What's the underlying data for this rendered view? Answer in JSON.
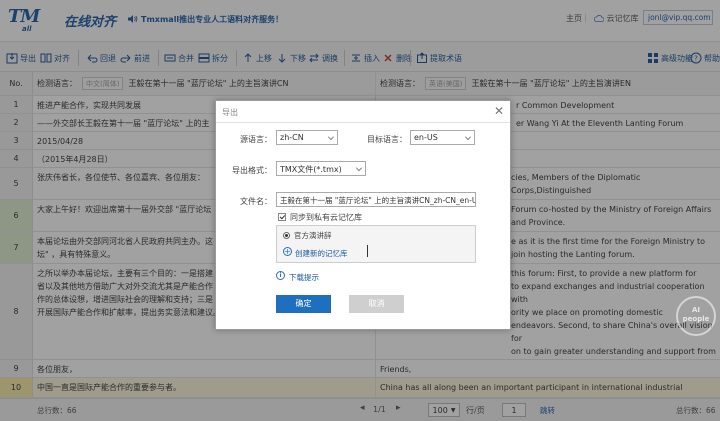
{
  "header": {
    "logo_mark": "TM",
    "logo_sub": "all",
    "logo_cn": "在线对齐",
    "announcement": "Tmxmall推出专业人工语料对齐服务！",
    "nav_home": "主页",
    "nav_cloud": "云记忆库",
    "user": "jonl@vip.qq.com"
  },
  "toolbar": {
    "export": "导出",
    "align": "对齐",
    "back": "回退",
    "forward": "前进",
    "merge": "合并",
    "split": "拆分",
    "move_up": "上移",
    "move_down": "下移",
    "swap": "调换",
    "insert": "插入",
    "delete": "删除",
    "extract_terms": "提取术语",
    "advanced": "高级功能",
    "help": "帮助"
  },
  "grid": {
    "header": {
      "no": "No.",
      "src_detect_label": "检测语言：",
      "src_lang": "中文(简体)",
      "src_file": "王毅在第十一届 \"蓝厅论坛\" 上的主旨演讲CN",
      "tgt_detect_label": "检测语言：",
      "tgt_lang": "英语(美国)",
      "tgt_file": "王毅在第十一届 \"蓝厅论坛\" 上的主旨演讲EN"
    },
    "rows": [
      {
        "no": "1",
        "src": "推进产能合作，实现共同发展",
        "tgt": "r Common Development"
      },
      {
        "no": "2",
        "src": "——外交部长王毅在第十一届 \"蓝厅论坛\" 上的主",
        "tgt": "er Wang Yi At the Eleventh Lanting Forum"
      },
      {
        "no": "3",
        "src": "2015/04/28",
        "tgt": ""
      },
      {
        "no": "4",
        "src": "（2015年4月28日）",
        "tgt": ""
      },
      {
        "no": "5",
        "src": "张庆伟省长，各位使节、各位嘉宾、各位朋友：",
        "tgt": "cies, Members of the Diplomatic Corps,Distinguished"
      },
      {
        "no": "6",
        "src": "大家上午好！欢迎出席第十一届外交部 \"蓝厅论坛",
        "tgt": "Forum co-hosted by the Ministry of Foreign Affairs and Province."
      },
      {
        "no": "7",
        "src": "本届论坛由外交部同河北省人民政府共同主办。这\n坛\" ，具有特殊意义。",
        "tgt": "e as it is the first time for the Foreign Ministry to join hosting the Lanting forum."
      },
      {
        "no": "8",
        "src": "之所以举办本届论坛，主要有三个目的：一是搭建\n省以及其他地方借助广大对外交流尤其是产能合作\n作的总体设想，增进国际社会的理解和支持；三是\n开展国际产能合作和扩献率，提出务实意法和建议。",
        "tgt": "this forum: First, to provide a new platform for\nto expand exchanges and industrial cooperation with\nority we place on promoting domestic\nendeavors. Second, to share China's overall vision for\non to gain greater understanding and support from the\ninternational community. Third, to encourage companies, experts, scholars and people\nfrom various sectors to contribute thoughts and wisdom to China's industrial\ncooperation with the rest of the world."
      },
      {
        "no": "9",
        "src": "各位朋友，",
        "tgt": "Friends,"
      },
      {
        "no": "10",
        "src": "中国一直是国际产能合作的重要参与者。",
        "tgt": "China has all along been an important participant in international industrial cooperation."
      }
    ]
  },
  "statusbar": {
    "src_count": "总行数：66",
    "page": "1/1",
    "page_size": "100",
    "per_page": "行/页",
    "goto_value": "1",
    "goto": "跳转",
    "tgt_count": "总行数：66"
  },
  "dialog": {
    "title": "导出",
    "src_lang_label": "源语言：",
    "src_lang_value": "zh-CN",
    "tgt_lang_label": "目标语言：",
    "tgt_lang_value": "en-US",
    "format_label": "导出格式：",
    "format_value": "TMX文件(*.tmx)",
    "filename_label": "文件名：",
    "filename_value": "王毅在第十一届 \"蓝厅论坛\" 上的主旨演讲CN_zh-CN_en-U",
    "sync_label": "同步到私有云记忆库",
    "tm_option": "官方演讲辞",
    "create_tm": "创建新的记忆库",
    "download_tip": "下载提示",
    "ok": "确定",
    "cancel": "取消"
  },
  "watermark": {
    "line1": "AI",
    "line2": "people"
  }
}
